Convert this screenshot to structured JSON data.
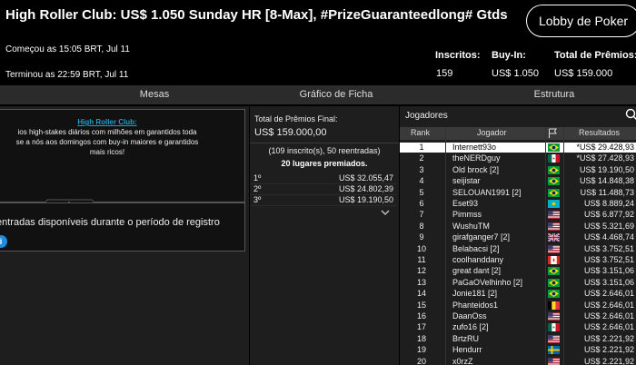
{
  "header": {
    "title": "High Roller Club: US$ 1.050 Sunday HR [8-Max], #PrizeGuaranteedlong# Gtds",
    "lobby_button": "Lobby de Poker",
    "started": "Começou as 15:05 BRT, Jul 11",
    "ended": "Terminou as 22:59 BRT, Jul 11",
    "stats": {
      "entrants_label": "Inscritos:",
      "entrants_value": "159",
      "buyin_label": "Buy-In:",
      "buyin_value": "US$ 1.050",
      "prize_label": "Total de Prêmios:",
      "prize_value": "US$ 159.000"
    }
  },
  "tabs": [
    "Mesas",
    "Gráfico de Ficha",
    "Estrutura"
  ],
  "info": {
    "heading": "High Roller Club:",
    "text_line1": "ios high-stakes diários com milhões em garantidos toda",
    "text_line2": "se a nós aos domingos com buy-in maiores e garantidos",
    "text_line3": "mais ricos!",
    "reentry": "entradas disponíveis durante o período de registro",
    "info_icon": "i"
  },
  "prizes": {
    "label": "Total de Prêmios Final:",
    "amount": "US$ 159.000,00",
    "entries": "(109 inscrito(s), 50 reentradas)",
    "places": "20 lugares premiados.",
    "rows": [
      {
        "pos": "1º",
        "value": "US$ 32.055,47"
      },
      {
        "pos": "2º",
        "value": "US$ 24.802,39"
      },
      {
        "pos": "3º",
        "value": "US$ 19.190,50"
      }
    ]
  },
  "players": {
    "heading": "Jogadores",
    "columns": {
      "rank": "Rank",
      "player": "Jogador",
      "results": "Resultados"
    },
    "rows": [
      {
        "rank": "1",
        "name": "Internett93o",
        "flag": "br",
        "result": "*US$ 29.428,93"
      },
      {
        "rank": "2",
        "name": "theNERDguy",
        "flag": "mx",
        "result": "*US$ 27.428,93"
      },
      {
        "rank": "3",
        "name": "Old brock [2]",
        "flag": "br",
        "result": "US$ 19.190,50"
      },
      {
        "rank": "4",
        "name": "seijistar",
        "flag": "br",
        "result": "US$ 14.848,38"
      },
      {
        "rank": "5",
        "name": "SELOUAN1991 [2]",
        "flag": "br",
        "result": "US$ 11.488,73"
      },
      {
        "rank": "6",
        "name": "Eset93",
        "flag": "kz",
        "result": "US$ 8.889,24"
      },
      {
        "rank": "7",
        "name": "Pimmss",
        "flag": "us",
        "result": "US$ 6.877,92"
      },
      {
        "rank": "8",
        "name": "WushuTM",
        "flag": "us",
        "result": "US$ 5.321,69"
      },
      {
        "rank": "9",
        "name": "girafganger7 [2]",
        "flag": "gb",
        "result": "US$ 4.468,74"
      },
      {
        "rank": "10",
        "name": "Belabacsi [2]",
        "flag": "us",
        "result": "US$ 3.752,51"
      },
      {
        "rank": "11",
        "name": "coolhanddany",
        "flag": "ca",
        "result": "US$ 3.752,51"
      },
      {
        "rank": "12",
        "name": "great dant [2]",
        "flag": "br",
        "result": "US$ 3.151,06"
      },
      {
        "rank": "13",
        "name": "PaGaOVelhinho [2]",
        "flag": "br",
        "result": "US$ 3.151,06"
      },
      {
        "rank": "14",
        "name": "Jonie181 [2]",
        "flag": "br",
        "result": "US$ 2.646,01"
      },
      {
        "rank": "15",
        "name": "Phanteidos1",
        "flag": "be",
        "result": "US$ 2.646,01"
      },
      {
        "rank": "16",
        "name": "DaanOss",
        "flag": "us",
        "result": "US$ 2.646,01"
      },
      {
        "rank": "17",
        "name": "zufo16 [2]",
        "flag": "mx",
        "result": "US$ 2.646,01"
      },
      {
        "rank": "18",
        "name": "BrtzRU",
        "flag": "us",
        "result": "US$ 2.221,92"
      },
      {
        "rank": "19",
        "name": "Hendurr",
        "flag": "se",
        "result": "US$ 2.221,92"
      },
      {
        "rank": "20",
        "name": "x0rzZ",
        "flag": "us",
        "result": "US$ 2.221,92"
      }
    ]
  }
}
